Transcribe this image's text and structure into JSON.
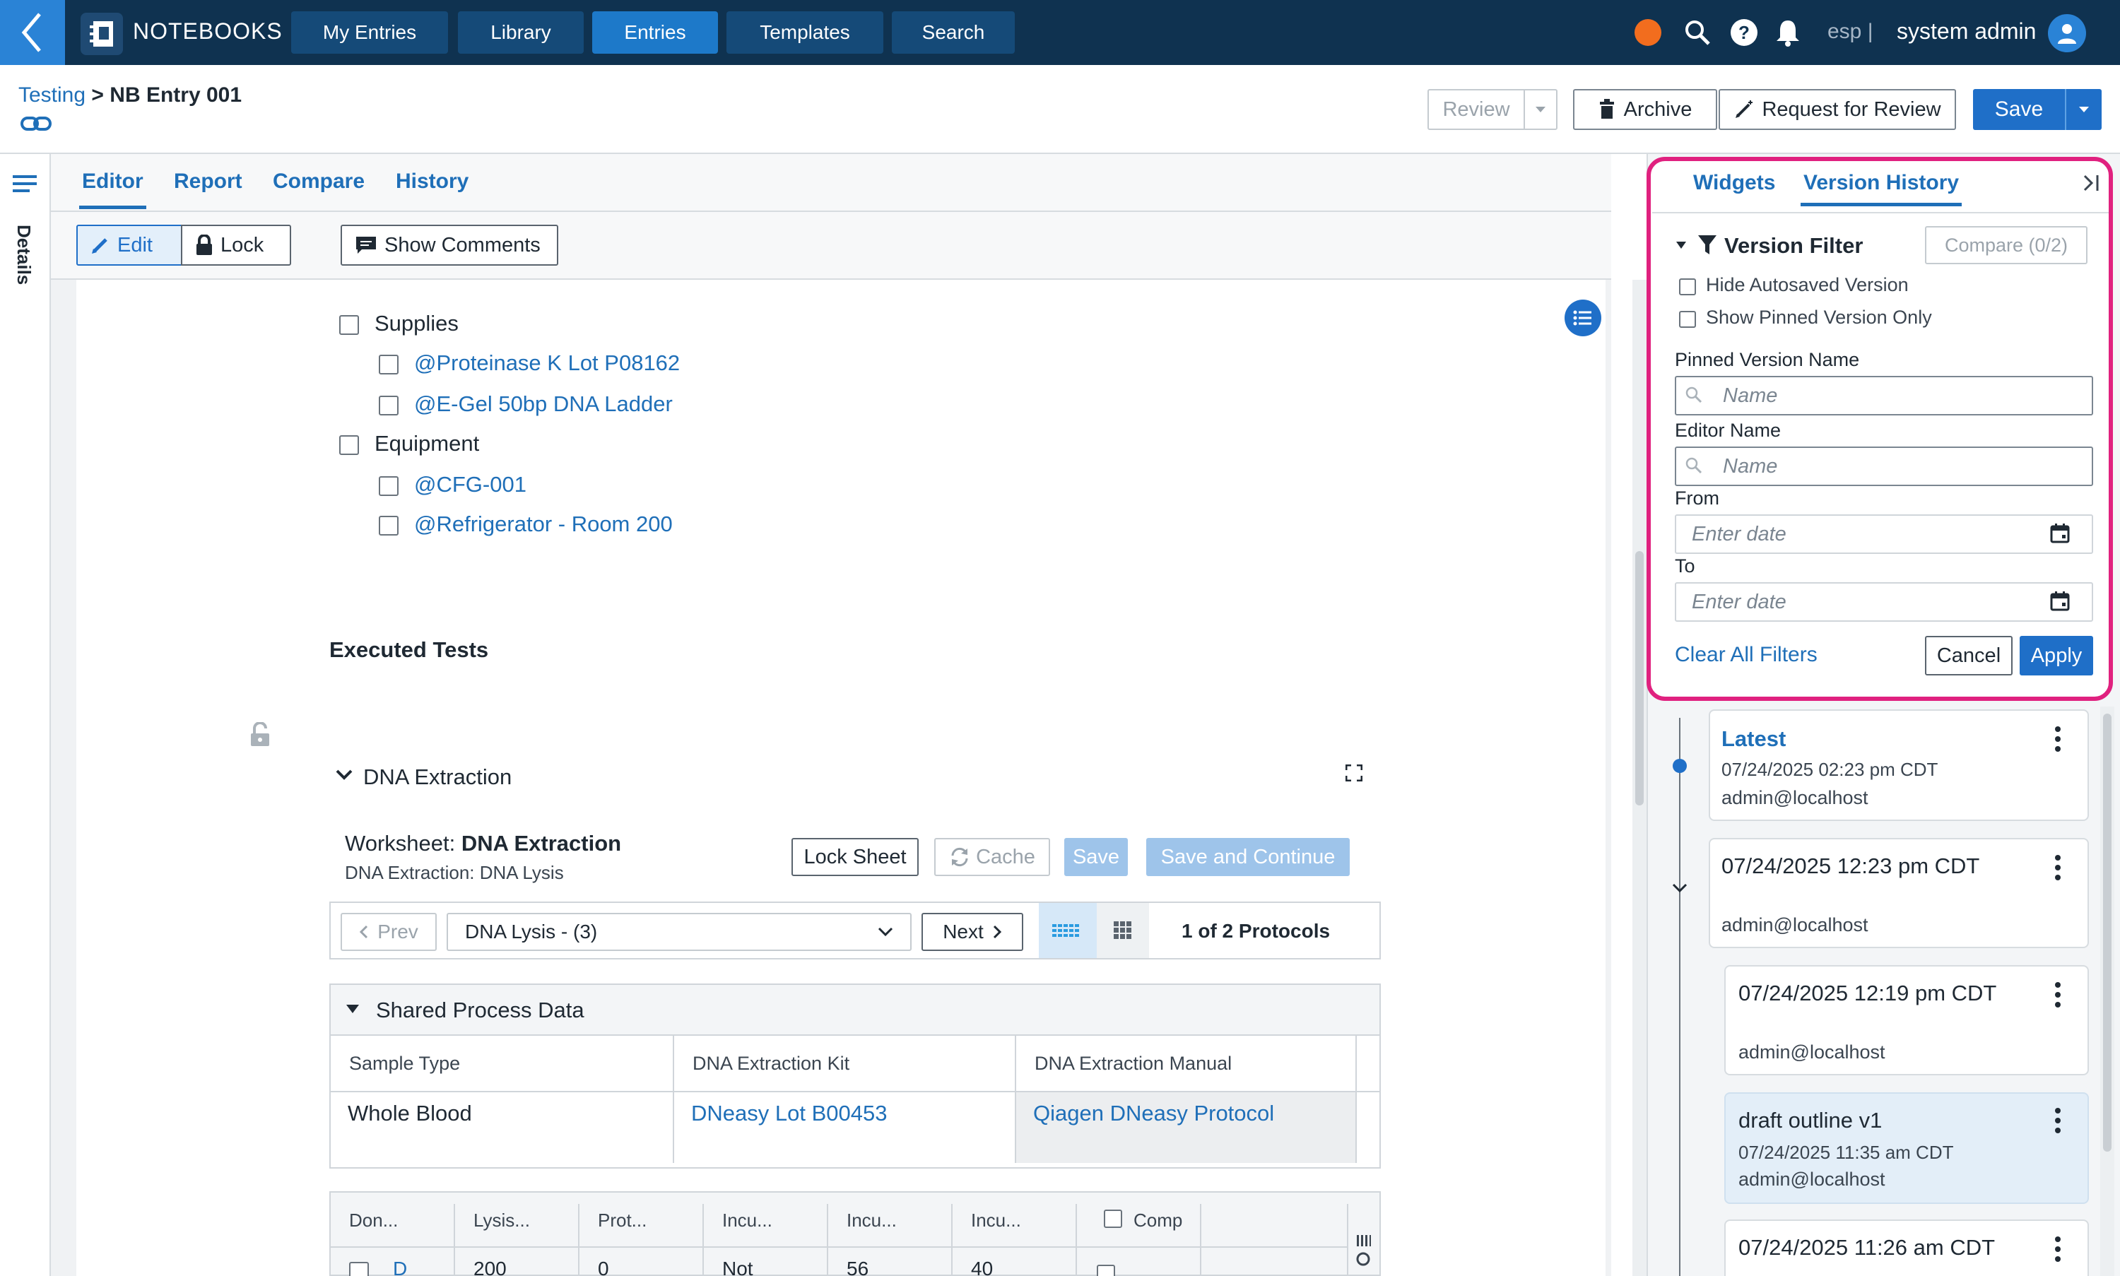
{
  "app": {
    "name": "NOTEBOOKS"
  },
  "nav": {
    "items": [
      {
        "label": "My Entries"
      },
      {
        "label": "Library"
      },
      {
        "label": "Entries"
      },
      {
        "label": "Templates"
      },
      {
        "label": "Search"
      }
    ],
    "active": "Entries"
  },
  "user": {
    "lang": "esp |",
    "name": "system admin"
  },
  "breadcrumb": {
    "parent": "Testing",
    "sep": ">",
    "current": "NB Entry 001"
  },
  "header_actions": {
    "review": "Review",
    "archive": "Archive",
    "request_review": "Request for Review",
    "save": "Save"
  },
  "sidebar": {
    "details": "Details"
  },
  "tabs": [
    {
      "label": "Editor"
    },
    {
      "label": "Report"
    },
    {
      "label": "Compare"
    },
    {
      "label": "History"
    }
  ],
  "toolbar": {
    "edit": "Edit",
    "lock": "Lock",
    "show_comments": "Show Comments"
  },
  "checklist": [
    {
      "label": "Supplies",
      "type": "text"
    },
    {
      "label": "@Proteinase K Lot P08162",
      "type": "link"
    },
    {
      "label": "@E-Gel 50bp DNA Ladder",
      "type": "link"
    },
    {
      "label": "Equipment",
      "type": "text"
    },
    {
      "label": "@CFG-001",
      "type": "link"
    },
    {
      "label": "@Refrigerator - Room 200",
      "type": "link"
    }
  ],
  "executed_tests": {
    "title": "Executed Tests"
  },
  "dna": {
    "section_title": "DNA Extraction",
    "worksheet_prefix": "Worksheet:",
    "worksheet_name": "DNA Extraction",
    "worksheet_sub": "DNA Extraction: DNA Lysis",
    "buttons": {
      "lock_sheet": "Lock Sheet",
      "cache": "Cache",
      "save": "Save",
      "save_continue": "Save and Continue"
    },
    "protocol": {
      "prev": "Prev",
      "selected": "DNA Lysis - (3)",
      "next": "Next",
      "count": "1 of 2 Protocols"
    },
    "shared": {
      "title": "Shared Process Data",
      "headers": [
        "Sample Type",
        "DNA Extraction Kit",
        "DNA Extraction Manual"
      ],
      "values": [
        "Whole Blood",
        "DNeasy Lot B00453",
        "Qiagen DNeasy Protocol"
      ]
    },
    "grid": {
      "headers": [
        "Don...",
        "Lysis...",
        "Prot...",
        "Incu...",
        "Incu...",
        "Incu...",
        "Comp"
      ],
      "row": [
        "D",
        "200",
        "0",
        "Not",
        "56",
        "40"
      ]
    }
  },
  "right_panel": {
    "tabs": [
      {
        "label": "Widgets"
      },
      {
        "label": "Version History"
      }
    ],
    "filter": {
      "title": "Version Filter",
      "compare": "Compare (0/2)",
      "hide_autosaved": "Hide Autosaved Version",
      "show_pinned": "Show Pinned Version Only",
      "pinned_label": "Pinned Version Name",
      "pinned_placeholder": "Name",
      "editor_label": "Editor Name",
      "editor_placeholder": "Name",
      "from_label": "From",
      "from_placeholder": "Enter date",
      "to_label": "To",
      "to_placeholder": "Enter date",
      "clear": "Clear All Filters",
      "cancel": "Cancel",
      "apply": "Apply"
    },
    "versions": [
      {
        "name": "Latest",
        "date": "07/24/2025 02:23 pm CDT",
        "user": "admin@localhost"
      },
      {
        "name": "07/24/2025 12:23 pm CDT",
        "date": "",
        "user": "admin@localhost"
      },
      {
        "name": "07/24/2025 12:19 pm CDT",
        "date": "",
        "user": "admin@localhost"
      },
      {
        "name": "draft outline v1",
        "date": "07/24/2025 11:35 am CDT",
        "user": "admin@localhost"
      },
      {
        "name": "07/24/2025 11:26 am CDT",
        "date": "",
        "user": ""
      }
    ]
  },
  "colors": {
    "topbar": "#0f3250",
    "accent": "#1f6fc8",
    "link": "#1f6fb8",
    "highlight": "#e0217f"
  }
}
